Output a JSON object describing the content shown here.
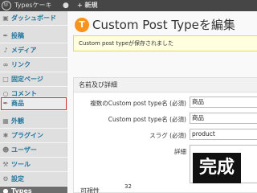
{
  "adminbar": {
    "site_name": "Typesケーキ",
    "comment_icon": "comment-bubble-icon",
    "new_label": "+ 新規"
  },
  "sidebar": {
    "items": [
      {
        "label": "ダッシュボード",
        "icon": "dashboard-icon"
      },
      {
        "label": "投稿",
        "icon": "pin-icon"
      },
      {
        "label": "メディア",
        "icon": "media-icon"
      },
      {
        "label": "リンク",
        "icon": "link-icon"
      },
      {
        "label": "固定ページ",
        "icon": "page-icon"
      },
      {
        "label": "コメント",
        "icon": "comment-icon"
      },
      {
        "label": "商品",
        "icon": "pin-icon"
      },
      {
        "label": "外観",
        "icon": "appearance-icon"
      },
      {
        "label": "プラグイン",
        "icon": "plugin-icon"
      },
      {
        "label": "ユーザー",
        "icon": "users-icon"
      },
      {
        "label": "ツール",
        "icon": "tools-icon"
      },
      {
        "label": "設定",
        "icon": "settings-icon"
      },
      {
        "label": "Types",
        "icon": "types-icon"
      }
    ]
  },
  "main": {
    "title": "Custom Post Typeを編集",
    "notice": "Custom post typeが保存されました",
    "section_title": "名前及び詳細",
    "fields": [
      {
        "label": "複数のCustom post type名 (必須)",
        "value": "商品"
      },
      {
        "label": "Custom post type名 (必須)",
        "value": "商品"
      },
      {
        "label": "スラグ (必須)",
        "value": "product"
      },
      {
        "label": "詳細",
        "value": ""
      }
    ],
    "visibility_label": "可視性",
    "page_number": "32",
    "overlay_text": "完成"
  },
  "colors": {
    "adminbar_bg": "#464646",
    "sidebar_bg": "#dfdfdf",
    "link_blue": "#21759b",
    "highlight_red": "#d23232",
    "types_orange": "#f7941d",
    "notice_bg": "#ffffe0"
  }
}
